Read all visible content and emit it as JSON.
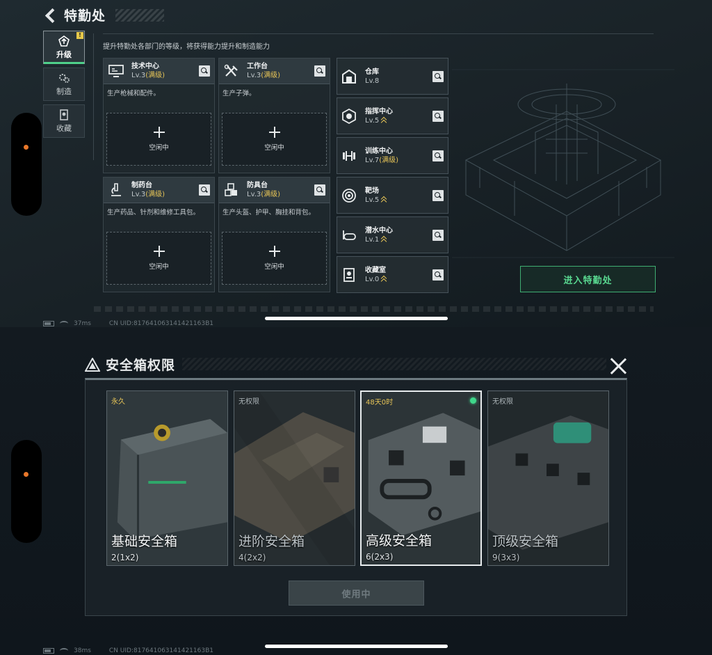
{
  "top": {
    "title": "特勤处",
    "nav": [
      {
        "label": "升级",
        "badge": "!"
      },
      {
        "label": "制造"
      },
      {
        "label": "收藏"
      }
    ],
    "subtitle": "提升特勤处各部门的等级，将获得能力提升和制造能力",
    "workstations": [
      {
        "name": "技术中心",
        "level": "Lv.3",
        "max": "(满级)",
        "desc": "生产枪械和配件。",
        "idle_label": "空闲中"
      },
      {
        "name": "工作台",
        "level": "Lv.3",
        "max": "(满级)",
        "desc": "生产子弹。",
        "idle_label": "空闲中"
      },
      {
        "name": "制药台",
        "level": "Lv.3",
        "max": "(满级)",
        "desc": "生产药品、针剂和维修工具包。",
        "idle_label": "空闲中"
      },
      {
        "name": "防具台",
        "level": "Lv.3",
        "max": "(满级)",
        "desc": "生产头盔、护甲、胸挂和背包。",
        "idle_label": "空闲中"
      }
    ],
    "departments": [
      {
        "name": "仓库",
        "level": "Lv.8",
        "max": "",
        "icon": "warehouse-icon"
      },
      {
        "name": "指挥中心",
        "level": "Lv.5",
        "max": "",
        "icon": "command-icon"
      },
      {
        "name": "训练中心",
        "level": "Lv.7",
        "max": "(满级)",
        "icon": "dumbbell-icon"
      },
      {
        "name": "靶场",
        "level": "Lv.5",
        "max": "",
        "icon": "target-icon"
      },
      {
        "name": "潜水中心",
        "level": "Lv.1",
        "max": "",
        "icon": "diving-icon"
      },
      {
        "name": "收藏室",
        "level": "Lv.0",
        "max": "",
        "icon": "collection-icon"
      }
    ],
    "enter_button": "进入特勤处",
    "status": {
      "ping": "37ms",
      "uid": "CN UID:817641063141421163B1"
    }
  },
  "bottom": {
    "title": "安全箱权限",
    "safes": [
      {
        "tag": "永久",
        "name": "基础安全箱",
        "size": "2(1x2)"
      },
      {
        "tag": "无权限",
        "name": "进阶安全箱",
        "size": "4(2x2)"
      },
      {
        "tag": "48天0时",
        "name": "高级安全箱",
        "size": "6(2x3)"
      },
      {
        "tag": "无权限",
        "name": "顶级安全箱",
        "size": "9(3x3)"
      }
    ],
    "use_button": "使用中",
    "status": {
      "ping": "38ms",
      "uid": "CN UID:817641063141421163B1"
    }
  },
  "colors": {
    "accent_green": "#4fd08a",
    "max_gold": "#e6c457",
    "bg": "#1a2328"
  }
}
